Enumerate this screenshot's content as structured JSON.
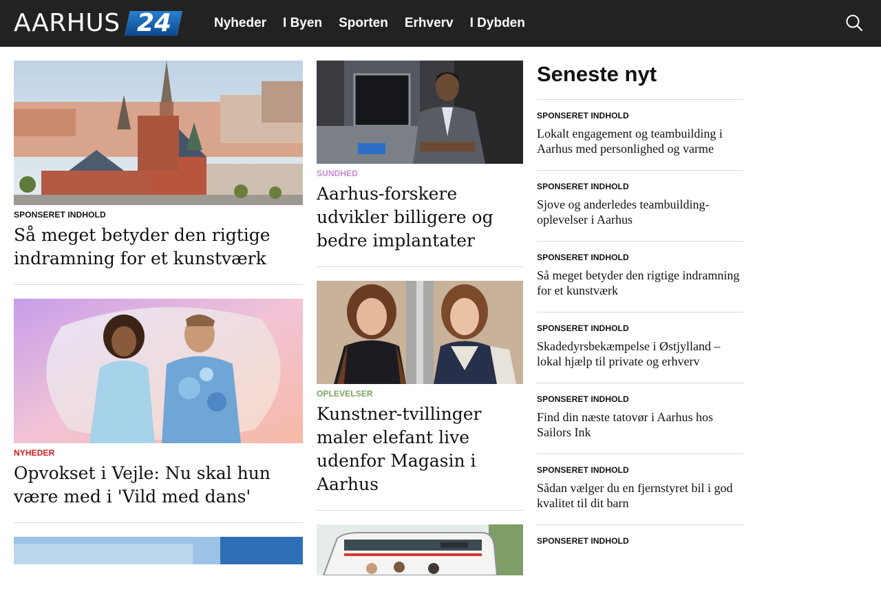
{
  "brand": {
    "name": "AARHUS",
    "badge": "24"
  },
  "nav": {
    "items": [
      "Nyheder",
      "I Byen",
      "Sporten",
      "Erhverv",
      "I Dybden"
    ]
  },
  "col1": [
    {
      "tag": "SPONSERET INDHOLD",
      "title": "Så meget betyder den rigtige indramning for et kunstværk"
    },
    {
      "tag": "NYHEDER",
      "title": "Opvokset i Vejle: Nu skal hun være med i 'Vild med dans'"
    }
  ],
  "col2": [
    {
      "tag": "SUNDHED",
      "title": "Aarhus-forskere udvikler billigere og bedre implantater"
    },
    {
      "tag": "OPLEVELSER",
      "title": "Kunstner-tvillinger maler elefant live udenfor Magasin i Aarhus"
    }
  ],
  "latest": {
    "title": "Seneste nyt",
    "items": [
      {
        "tag": "SPONSERET INDHOLD",
        "title": "Lokalt engagement og teambuilding i Aarhus med personlighed og varme"
      },
      {
        "tag": "SPONSERET INDHOLD",
        "title": "Sjove og anderledes teambuilding-oplevelser i Aarhus"
      },
      {
        "tag": "SPONSERET INDHOLD",
        "title": "Så meget betyder den rigtige indramning for et kunstværk"
      },
      {
        "tag": "SPONSERET INDHOLD",
        "title": "Skadedyrsbekæmpelse i Østjylland – lokal hjælp til private og erhverv"
      },
      {
        "tag": "SPONSERET INDHOLD",
        "title": "Find din næste tatovør i Aarhus hos Sailors Ink"
      },
      {
        "tag": "SPONSERET INDHOLD",
        "title": "Sådan vælger du en fjernstyret bil i god kvalitet til dit barn"
      },
      {
        "tag": "SPONSERET INDHOLD",
        "title": ""
      }
    ]
  },
  "colors": {
    "header_bg": "#222222",
    "tag_red": "#d21b1b",
    "tag_purple": "#c889d8",
    "tag_green": "#7ba35d",
    "divider": "#d9d9d9"
  }
}
